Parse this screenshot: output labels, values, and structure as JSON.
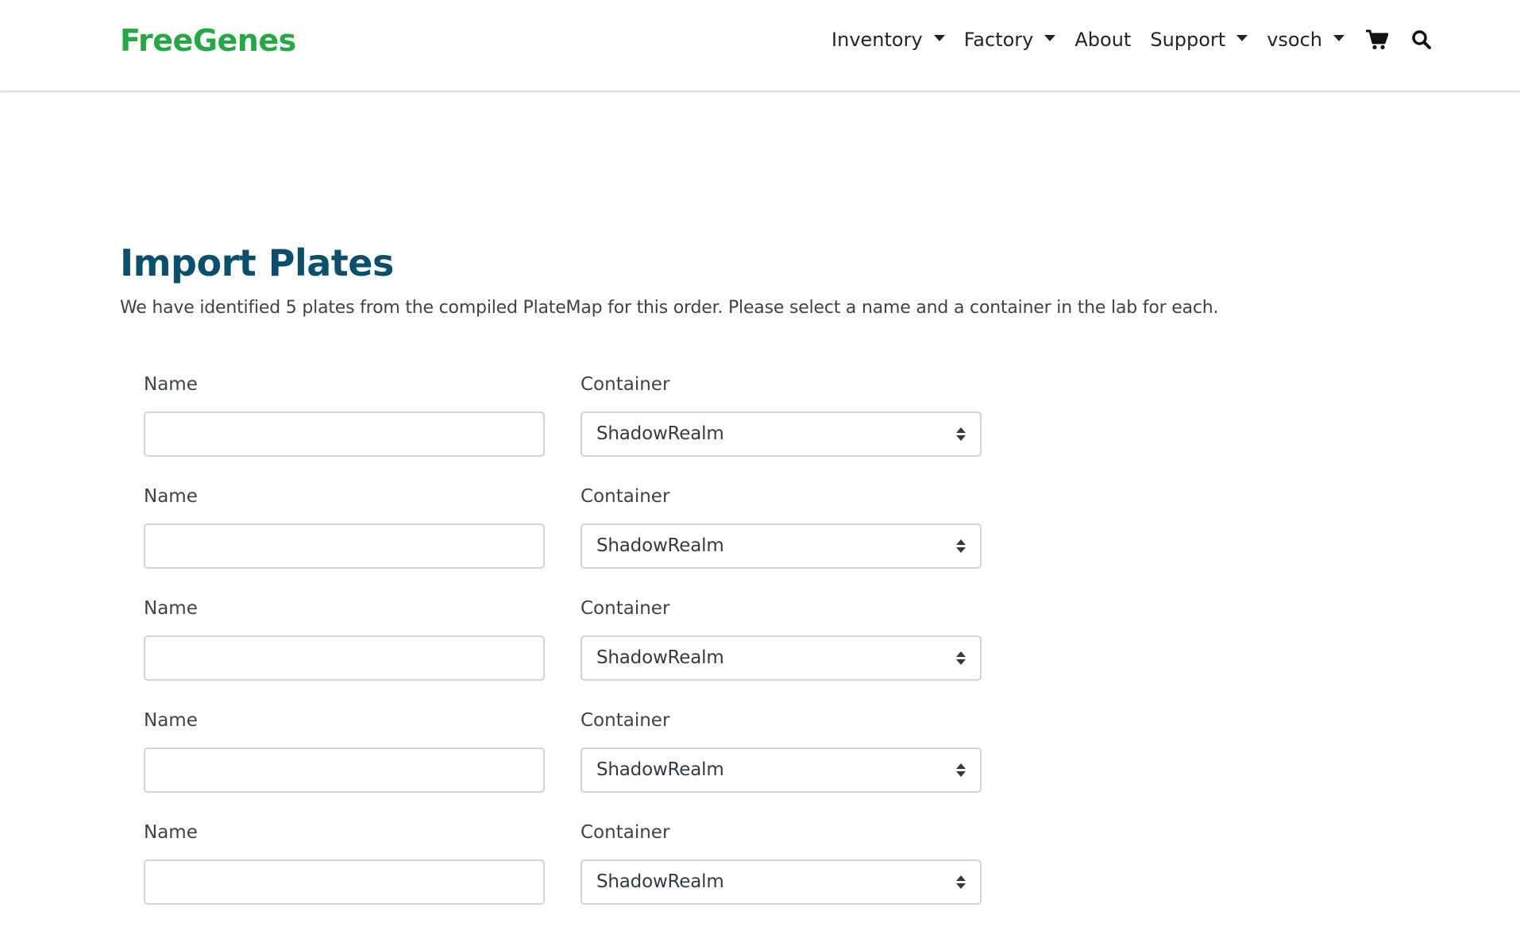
{
  "colors": {
    "brand": "#28a745",
    "title": "#0b4f6c",
    "text": "#343a40",
    "border": "#ced4da"
  },
  "navbar": {
    "brand": "FreeGenes",
    "items": [
      {
        "label": "Inventory",
        "dropdown": true
      },
      {
        "label": "Factory",
        "dropdown": true
      },
      {
        "label": "About",
        "dropdown": false
      },
      {
        "label": "Support",
        "dropdown": true
      },
      {
        "label": "vsoch",
        "dropdown": true
      }
    ],
    "icons": [
      "shopping-cart-icon",
      "search-icon"
    ]
  },
  "main": {
    "title": "Import Plates",
    "intro": "We have identified 5 plates from the compiled PlateMap for this order. Please select a name and a container in the lab for each.",
    "plates": [
      {
        "name_label": "Name",
        "name_value": "",
        "container_label": "Container",
        "container_value": "ShadowRealm"
      },
      {
        "name_label": "Name",
        "name_value": "",
        "container_label": "Container",
        "container_value": "ShadowRealm"
      },
      {
        "name_label": "Name",
        "name_value": "",
        "container_label": "Container",
        "container_value": "ShadowRealm"
      },
      {
        "name_label": "Name",
        "name_value": "",
        "container_label": "Container",
        "container_value": "ShadowRealm"
      },
      {
        "name_label": "Name",
        "name_value": "",
        "container_label": "Container",
        "container_value": "ShadowRealm"
      }
    ]
  }
}
